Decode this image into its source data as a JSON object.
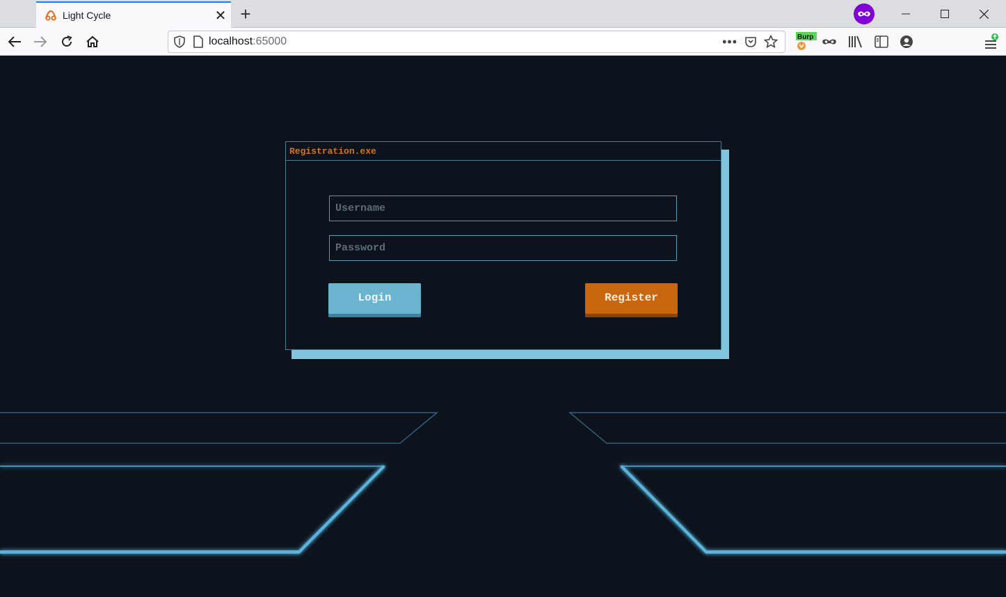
{
  "browser": {
    "tab_title": "Light Cycle",
    "url_host": "localhost",
    "url_port": ":65000",
    "burp_label": "Burp",
    "private_color": "#8000d7"
  },
  "page": {
    "panel_title": "Registration.exe",
    "username_placeholder": "Username",
    "password_placeholder": "Password",
    "login_label": "Login",
    "register_label": "Register"
  },
  "colors": {
    "background": "#0c131d",
    "accent_blue": "#6ab4d0",
    "accent_orange": "#c96711",
    "title_orange": "#d1761f"
  }
}
